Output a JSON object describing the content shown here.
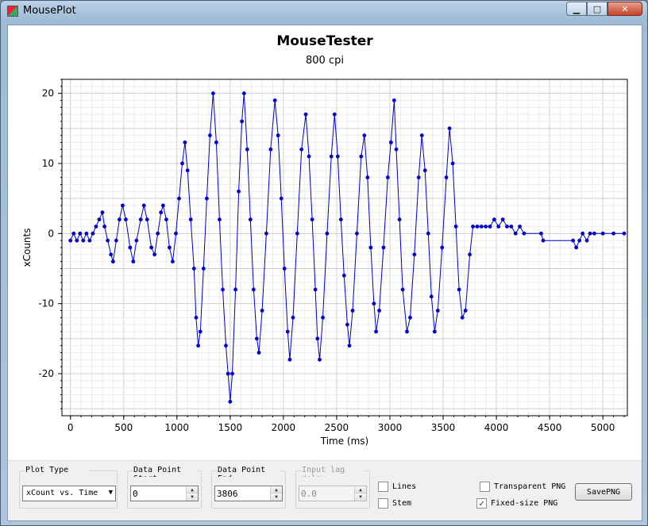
{
  "window": {
    "title": "MousePlot",
    "controls": {
      "minimize": "▁",
      "maximize": "□",
      "close": "✕"
    }
  },
  "chart_data": {
    "type": "scatter",
    "title": "MouseTester",
    "subtitle": "800 cpi",
    "xlabel": "Time (ms)",
    "ylabel": "xCounts",
    "xlim": [
      -80,
      5230
    ],
    "ylim": [
      -26,
      22
    ],
    "xticks": [
      0,
      500,
      1000,
      1500,
      2000,
      2500,
      3000,
      3500,
      4000,
      4500,
      5000
    ],
    "yticks": [
      -20,
      -10,
      0,
      10,
      20
    ],
    "grid": true,
    "series": [
      {
        "color": "#0000cc",
        "markers": true,
        "line": true,
        "points": [
          [
            0,
            -1
          ],
          [
            30,
            0
          ],
          [
            60,
            -1
          ],
          [
            90,
            0
          ],
          [
            120,
            -1
          ],
          [
            150,
            0
          ],
          [
            180,
            -1
          ],
          [
            210,
            0
          ],
          [
            240,
            1
          ],
          [
            270,
            2
          ],
          [
            300,
            3
          ],
          [
            320,
            1
          ],
          [
            350,
            -1
          ],
          [
            380,
            -3
          ],
          [
            400,
            -4
          ],
          [
            430,
            -1
          ],
          [
            460,
            2
          ],
          [
            490,
            4
          ],
          [
            520,
            2
          ],
          [
            560,
            -2
          ],
          [
            590,
            -4
          ],
          [
            620,
            -1
          ],
          [
            660,
            2
          ],
          [
            690,
            4
          ],
          [
            720,
            2
          ],
          [
            760,
            -2
          ],
          [
            790,
            -3
          ],
          [
            820,
            0
          ],
          [
            850,
            3
          ],
          [
            870,
            4
          ],
          [
            900,
            2
          ],
          [
            930,
            -2
          ],
          [
            960,
            -4
          ],
          [
            990,
            0
          ],
          [
            1020,
            5
          ],
          [
            1050,
            10
          ],
          [
            1075,
            13
          ],
          [
            1100,
            9
          ],
          [
            1130,
            2
          ],
          [
            1160,
            -5
          ],
          [
            1180,
            -12
          ],
          [
            1200,
            -16
          ],
          [
            1220,
            -14
          ],
          [
            1250,
            -5
          ],
          [
            1280,
            5
          ],
          [
            1310,
            14
          ],
          [
            1340,
            20
          ],
          [
            1370,
            13
          ],
          [
            1400,
            2
          ],
          [
            1430,
            -8
          ],
          [
            1460,
            -16
          ],
          [
            1480,
            -20
          ],
          [
            1500,
            -24
          ],
          [
            1520,
            -20
          ],
          [
            1550,
            -8
          ],
          [
            1580,
            6
          ],
          [
            1610,
            16
          ],
          [
            1630,
            20
          ],
          [
            1660,
            12
          ],
          [
            1690,
            2
          ],
          [
            1720,
            -8
          ],
          [
            1750,
            -15
          ],
          [
            1770,
            -17
          ],
          [
            1800,
            -11
          ],
          [
            1840,
            0
          ],
          [
            1880,
            12
          ],
          [
            1920,
            19
          ],
          [
            1950,
            14
          ],
          [
            1980,
            5
          ],
          [
            2010,
            -5
          ],
          [
            2040,
            -14
          ],
          [
            2060,
            -18
          ],
          [
            2090,
            -12
          ],
          [
            2130,
            0
          ],
          [
            2170,
            12
          ],
          [
            2210,
            17
          ],
          [
            2240,
            11
          ],
          [
            2270,
            2
          ],
          [
            2300,
            -8
          ],
          [
            2320,
            -15
          ],
          [
            2340,
            -18
          ],
          [
            2370,
            -12
          ],
          [
            2410,
            0
          ],
          [
            2450,
            11
          ],
          [
            2480,
            17
          ],
          [
            2510,
            11
          ],
          [
            2540,
            2
          ],
          [
            2570,
            -6
          ],
          [
            2600,
            -13
          ],
          [
            2620,
            -16
          ],
          [
            2650,
            -11
          ],
          [
            2690,
            0
          ],
          [
            2730,
            11
          ],
          [
            2760,
            14
          ],
          [
            2790,
            8
          ],
          [
            2820,
            -2
          ],
          [
            2850,
            -10
          ],
          [
            2870,
            -14
          ],
          [
            2900,
            -11
          ],
          [
            2940,
            -2
          ],
          [
            2980,
            8
          ],
          [
            3010,
            13
          ],
          [
            3040,
            19
          ],
          [
            3060,
            12
          ],
          [
            3090,
            2
          ],
          [
            3120,
            -8
          ],
          [
            3160,
            -14
          ],
          [
            3190,
            -12
          ],
          [
            3230,
            -3
          ],
          [
            3270,
            8
          ],
          [
            3300,
            14
          ],
          [
            3330,
            9
          ],
          [
            3360,
            0
          ],
          [
            3390,
            -9
          ],
          [
            3420,
            -14
          ],
          [
            3450,
            -11
          ],
          [
            3490,
            -2
          ],
          [
            3530,
            8
          ],
          [
            3560,
            15
          ],
          [
            3590,
            10
          ],
          [
            3620,
            1
          ],
          [
            3650,
            -8
          ],
          [
            3680,
            -12
          ],
          [
            3710,
            -11
          ],
          [
            3750,
            -3
          ],
          [
            3780,
            1
          ],
          [
            3820,
            1
          ],
          [
            3860,
            1
          ],
          [
            3900,
            1
          ],
          [
            3940,
            1
          ],
          [
            3980,
            2
          ],
          [
            4020,
            1
          ],
          [
            4060,
            2
          ],
          [
            4100,
            1
          ],
          [
            4140,
            1
          ],
          [
            4180,
            0
          ],
          [
            4220,
            1
          ],
          [
            4260,
            0
          ],
          [
            4420,
            0
          ],
          [
            4440,
            -1
          ],
          [
            4720,
            -1
          ],
          [
            4750,
            -2
          ],
          [
            4780,
            -1
          ],
          [
            4810,
            0
          ],
          [
            4850,
            -1
          ],
          [
            4880,
            0
          ],
          [
            4920,
            0
          ],
          [
            5000,
            0
          ],
          [
            5100,
            0
          ],
          [
            5200,
            0
          ]
        ]
      }
    ]
  },
  "controls": {
    "plot_type": {
      "label": "Plot Type",
      "value": "xCount vs. Time",
      "arrow": "▼"
    },
    "data_point_start": {
      "label": "Data Point Start",
      "value": "0"
    },
    "data_point_end": {
      "label": "Data Point End",
      "value": "3806"
    },
    "input_lag": {
      "label": "Input lag delay",
      "value": "0.0"
    },
    "lines": {
      "label": "Lines",
      "checked": false
    },
    "stem": {
      "label": "Stem",
      "checked": false
    },
    "transparent_png": {
      "label": "Transparent PNG",
      "checked": false
    },
    "fixed_size_png": {
      "label": "Fixed-size PNG",
      "checked": true,
      "mark": "✓"
    },
    "save_png": {
      "label": "SavePNG"
    }
  }
}
